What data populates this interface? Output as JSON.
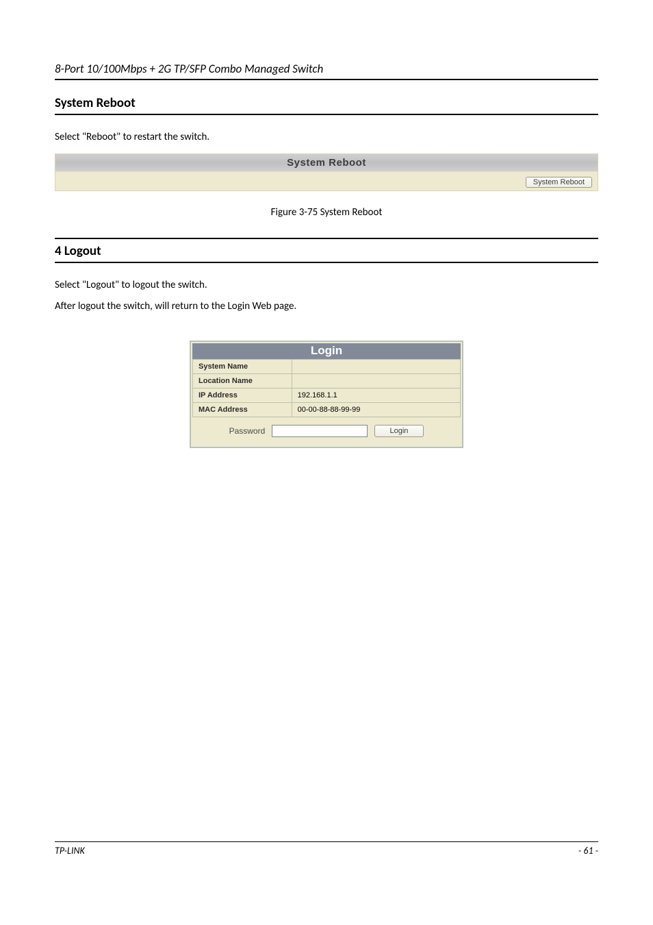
{
  "header": {
    "product_line": "8-Port 10/100Mbps + 2G TP/SFP Combo Managed Switch"
  },
  "reboot_section": {
    "title": "System Reboot",
    "desc": "Select \"Reboot\" to restart the switch.",
    "panel_title": "System Reboot",
    "button_label": "System Reboot",
    "figure_caption": "Figure 3-75 System Reboot"
  },
  "logout_section": {
    "title": "4 Logout",
    "desc_1": "Select \"Logout\" to logout the switch.",
    "desc_2": "After logout the switch, will return to the Login Web page."
  },
  "login_box": {
    "title": "Login",
    "rows": [
      {
        "label": "System Name",
        "value": ""
      },
      {
        "label": "Location Name",
        "value": ""
      },
      {
        "label": "IP Address",
        "value": "192.168.1.1"
      },
      {
        "label": "MAC Address",
        "value": "00-00-88-88-99-99"
      }
    ],
    "password_label": "Password",
    "login_button_label": "Login"
  },
  "footer": {
    "left": "TP-LINK",
    "right": "- 61 -"
  }
}
